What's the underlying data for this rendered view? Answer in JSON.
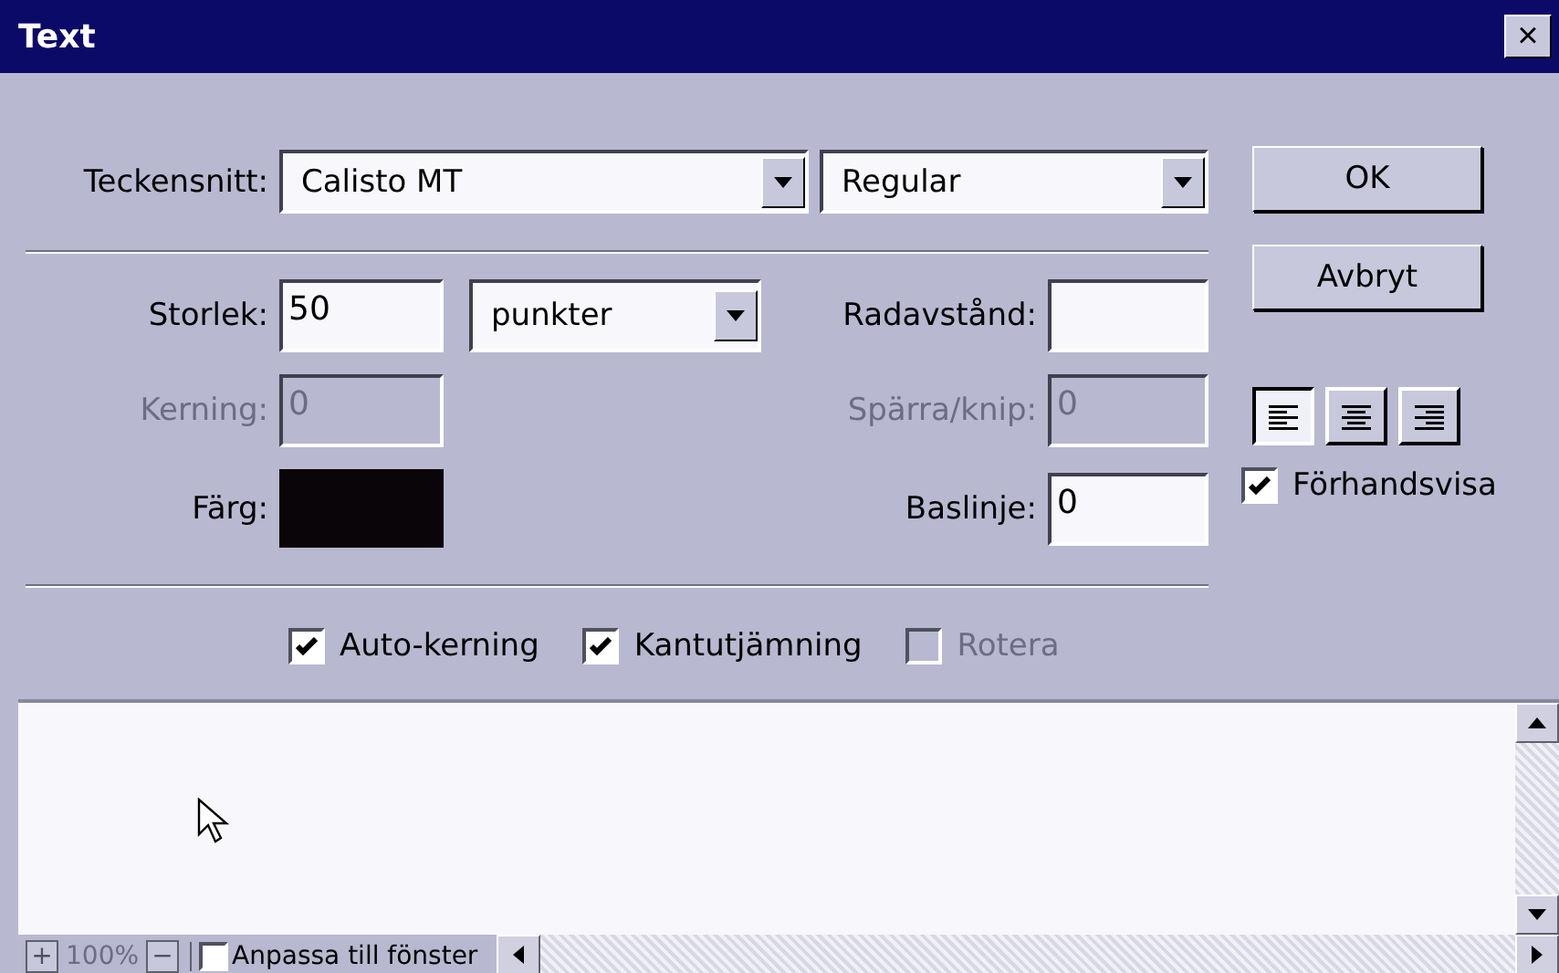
{
  "window": {
    "title": "Text",
    "close": "×"
  },
  "font_row": {
    "label": "Teckensnitt:",
    "font": "Calisto MT",
    "style": "Regular"
  },
  "fields": [
    {
      "kind": "size",
      "label": "Storlek:",
      "value": "50",
      "unit": "punkter",
      "disabled": false,
      "label2": "Radavstånd:",
      "disabled2": false
    },
    {
      "kind": "plain",
      "label": "Kerning:",
      "value": "0",
      "disabled": true,
      "label2": "Spärra/knip:",
      "value2": "0",
      "disabled2": true
    },
    {
      "kind": "color",
      "label": "Färg:",
      "color": "#0a0508",
      "label2": "Baslinje:",
      "value2": "0",
      "disabled2": false
    }
  ],
  "buttons": [
    "OK",
    "Avbryt"
  ],
  "alignment": [
    {
      "kind": "left",
      "selected": true
    },
    {
      "kind": "center",
      "selected": false
    },
    {
      "kind": "right",
      "selected": false
    }
  ],
  "preview": {
    "label": "Förhandsvisa",
    "checked": true
  },
  "options": [
    {
      "label": "Auto-kerning",
      "checked": true,
      "disabled": false
    },
    {
      "label": "Kantutjämning",
      "checked": true,
      "disabled": false
    },
    {
      "label": "Rotera",
      "checked": false,
      "disabled": true
    }
  ],
  "status_bar": {
    "zoom_in": "+",
    "zoom": "100%",
    "zoom_out": "−",
    "fit": {
      "label": "Anpassa till fönster",
      "checked": false
    }
  }
}
